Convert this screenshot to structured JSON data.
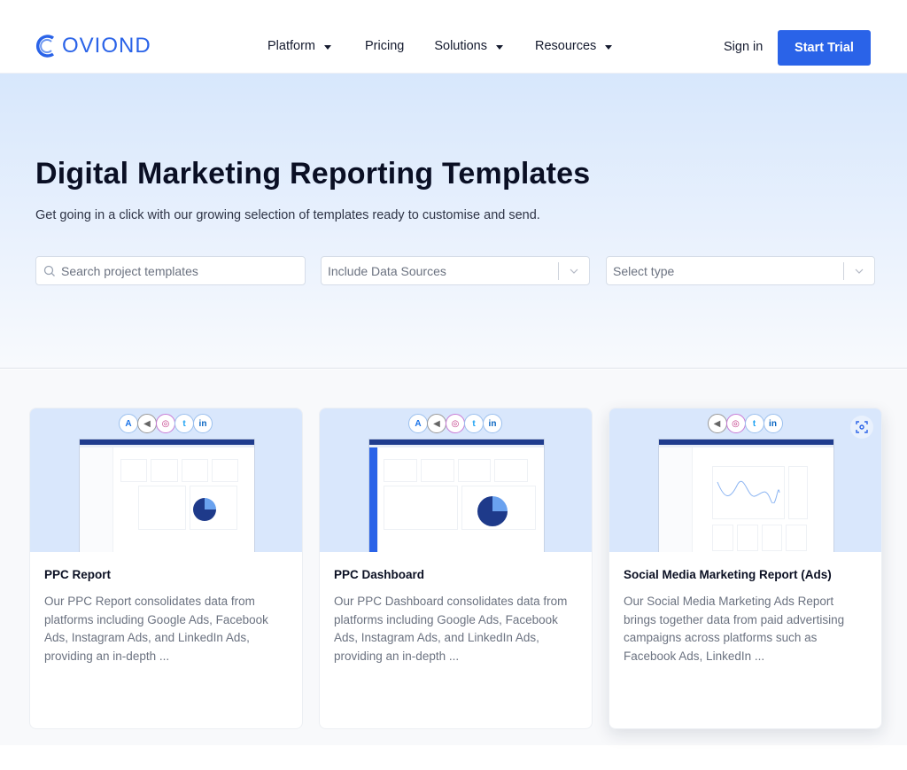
{
  "brand": {
    "name": "OVIOND",
    "accent": "#2a63e8"
  },
  "nav": {
    "items": [
      {
        "label": "Platform",
        "has_dropdown": true
      },
      {
        "label": "Pricing",
        "has_dropdown": false
      },
      {
        "label": "Solutions",
        "has_dropdown": true
      },
      {
        "label": "Resources",
        "has_dropdown": true
      }
    ],
    "signin_label": "Sign in",
    "trial_label": "Start Trial"
  },
  "hero": {
    "title": "Digital Marketing Reporting Templates",
    "subtitle": "Get going in a click with our growing selection of templates ready to customise and send.",
    "search": {
      "placeholder": "Search project templates",
      "value": ""
    },
    "data_sources_select": {
      "placeholder": "Include Data Sources"
    },
    "type_select": {
      "placeholder": "Select type"
    }
  },
  "cards": [
    {
      "title": "PPC Report",
      "description": "Our PPC Report consolidates data from platforms including Google Ads, Facebook Ads, Instagram Ads, and LinkedIn Ads, providing an in-depth ...",
      "sources": [
        "google-ads-icon",
        "facebook-ads-icon",
        "instagram-ads-icon",
        "twitter-ads-icon",
        "linkedin-ads-icon"
      ]
    },
    {
      "title": "PPC Dashboard",
      "description": "Our PPC Dashboard consolidates data from platforms including Google Ads, Facebook Ads, Instagram Ads, and LinkedIn Ads, providing an in-depth ...",
      "sources": [
        "google-ads-icon",
        "facebook-ads-icon",
        "instagram-ads-icon",
        "twitter-ads-icon",
        "linkedin-ads-icon"
      ]
    },
    {
      "title": "Social Media Marketing Report (Ads)",
      "description": "Our Social Media Marketing Ads Report brings together data from paid advertising campaigns across platforms such as Facebook Ads, LinkedIn ...",
      "sources": [
        "facebook-ads-icon",
        "instagram-ads-icon",
        "twitter-ads-icon",
        "linkedin-ads-icon"
      ]
    }
  ],
  "icons": {
    "google": "A",
    "facebook": "◀",
    "instagram": "◎",
    "twitter": "t",
    "linkedin": "in"
  }
}
